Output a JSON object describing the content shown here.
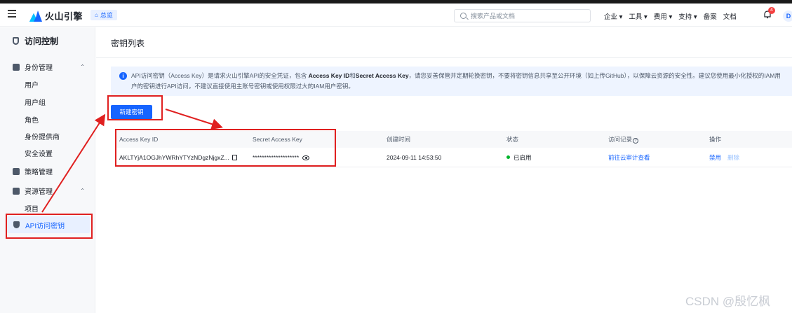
{
  "header": {
    "brand": "火山引擎",
    "home_chip": "总览",
    "search_placeholder": "搜索产品或文档",
    "nav": [
      "企业 ▾",
      "工具 ▾",
      "费用 ▾",
      "支持 ▾",
      "备案",
      "文档"
    ],
    "notification_count": "4",
    "avatar_letter": "D"
  },
  "sidebar": {
    "title": "访问控制",
    "group_identity": "身份管理",
    "identity_items": [
      "用户",
      "用户组",
      "角色",
      "身份提供商",
      "安全设置"
    ],
    "group_policy": "策略管理",
    "group_resource": "资源管理",
    "resource_items": [
      "项目"
    ],
    "active_item": "API访问密钥"
  },
  "main": {
    "title": "密钥列表",
    "notice_part1": "API访问密钥（Access Key）是请求火山引擎API的安全凭证，包含 ",
    "notice_bold1": "Access Key ID",
    "notice_and": "和",
    "notice_bold2": "Secret Access Key",
    "notice_part2": "，请您妥善保管并定期轮换密钥，不要将密钥信息共享至公开环境（如上传GitHub），以保障云资源的安全性。建议您使用最小化授权的IAM用户的密钥进行API访问，不建议直接使用主账号密钥或使用权限过大的IAM用户密钥。",
    "create_button": "新建密钥"
  },
  "table": {
    "headers": [
      "Access Key ID",
      "Secret Access Key",
      "创建时间",
      "状态",
      "访问记录",
      "操作"
    ],
    "rows": [
      {
        "access_key_id": "AKLTYjA1OGJhYWRhYTYzNDgzNjgxZ...",
        "secret": "********************",
        "created": "2024-09-11 14:53:50",
        "status": "已启用",
        "audit_link": "前往云审计查看",
        "action_disable": "禁用",
        "action_delete": "删除"
      }
    ]
  },
  "watermark": "CSDN @殷忆枫"
}
